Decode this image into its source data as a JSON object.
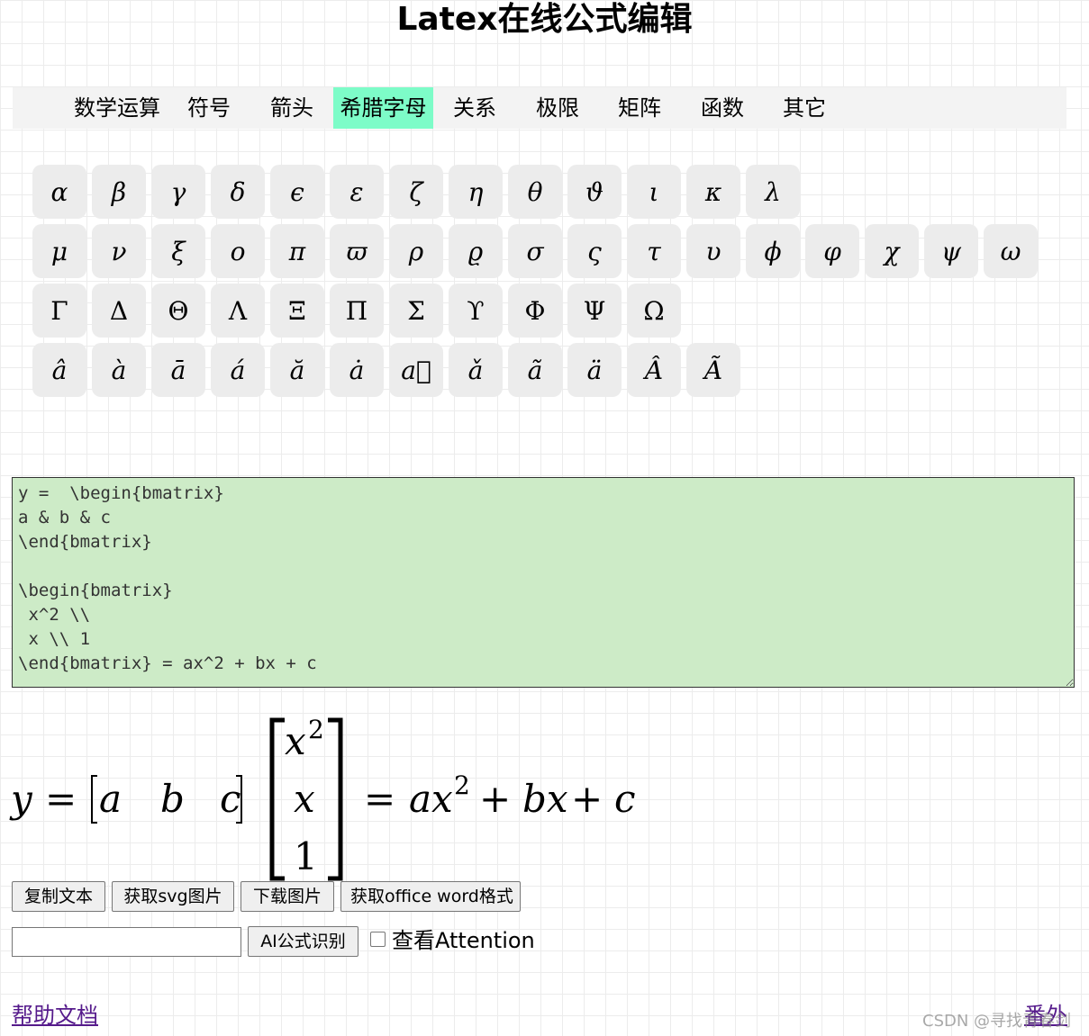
{
  "page": {
    "title": "Latex在线公式编辑"
  },
  "tabs": [
    {
      "label": "数学运算",
      "active": false
    },
    {
      "label": "符号",
      "active": false
    },
    {
      "label": "箭头",
      "active": false
    },
    {
      "label": "希腊字母",
      "active": true
    },
    {
      "label": "关系",
      "active": false
    },
    {
      "label": "极限",
      "active": false
    },
    {
      "label": "矩阵",
      "active": false
    },
    {
      "label": "函数",
      "active": false
    },
    {
      "label": "其它",
      "active": false
    }
  ],
  "colors": {
    "active_tab": "#7dfcc8",
    "editor_bg": "#cdebc7",
    "link": "#551a8b"
  },
  "symbols": {
    "lowercase_row1": [
      "α",
      "β",
      "γ",
      "δ",
      "ϵ",
      "ε",
      "ζ",
      "η",
      "θ",
      "ϑ",
      "ι",
      "κ",
      "λ"
    ],
    "lowercase_row2": [
      "μ",
      "ν",
      "ξ",
      "ο",
      "π",
      "ϖ",
      "ρ",
      "ϱ",
      "σ",
      "ς",
      "τ",
      "υ",
      "ϕ",
      "φ",
      "χ",
      "ψ",
      "ω"
    ],
    "uppercase": [
      "Γ",
      "Δ",
      "Θ",
      "Λ",
      "Ξ",
      "Π",
      "Σ",
      "ϒ",
      "Φ",
      "Ψ",
      "Ω"
    ],
    "accents": [
      "â",
      "à",
      "ā",
      "á",
      "ă",
      "ȧ",
      "a⃗",
      "ǎ",
      "ã",
      "ä",
      "Â",
      "Ã"
    ]
  },
  "editor": {
    "value": "y =  \\begin{bmatrix}\na & b & c\n\\end{bmatrix}\n\n\\begin{bmatrix}\n x^2 \\\\\n x \\\\ 1\n\\end{bmatrix} = ax^2 + bx + c"
  },
  "formula": {
    "lhs": "y",
    "eq": "=",
    "row_vector": [
      "a",
      "b",
      "c"
    ],
    "col_vector": [
      "x",
      "x",
      "1"
    ],
    "col_exp": "2",
    "rhs_ax": "ax",
    "rhs_exp": "2",
    "rhs_plus1": "+",
    "rhs_bx": "bx",
    "rhs_plus2": "+",
    "rhs_c": "c"
  },
  "buttons": {
    "copy_text": "复制文本",
    "get_svg": "获取svg图片",
    "download_image": "下载图片",
    "get_word": "获取office word格式",
    "ai_recognize": "AI公式识别"
  },
  "ai_input": {
    "value": "",
    "placeholder": ""
  },
  "attention": {
    "label": "查看Attention",
    "checked": false
  },
  "footer": {
    "help_link": "帮助文档",
    "extra_link": "番外",
    "watermark": "CSDN @寻找青春剑"
  }
}
